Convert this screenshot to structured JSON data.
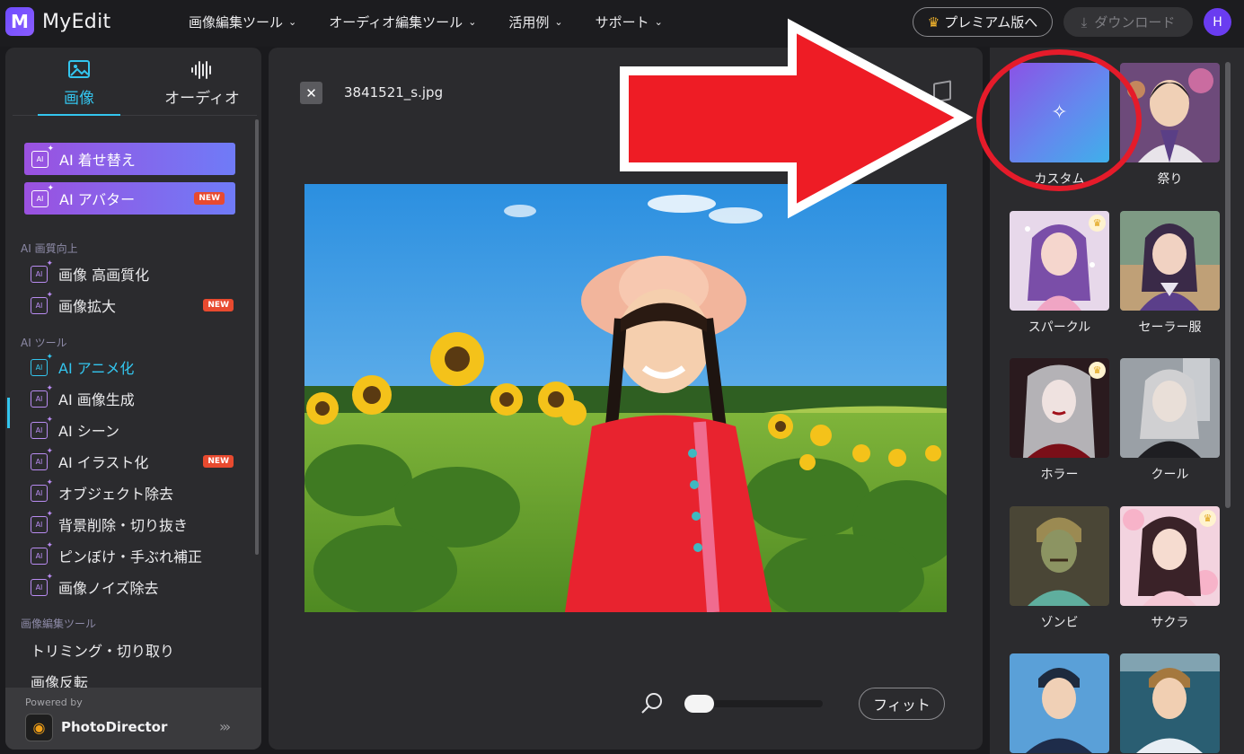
{
  "app": {
    "logo_glyph": "M",
    "name": "MyEdit"
  },
  "nav": [
    {
      "label": "画像編集ツール"
    },
    {
      "label": "オーディオ編集ツール"
    },
    {
      "label": "活用例"
    },
    {
      "label": "サポート"
    }
  ],
  "header": {
    "premium_label": "プレミアム版へ",
    "download_label": "ダウンロード",
    "avatar_initial": "H"
  },
  "sidebar": {
    "tabs": [
      {
        "label": "画像",
        "icon": "image-icon",
        "active": true
      },
      {
        "label": "オーディオ",
        "icon": "audio-waveform-icon",
        "active": false
      }
    ],
    "featured": [
      {
        "label": "AI 着せ替え",
        "badge": ""
      },
      {
        "label": "AI アバター",
        "badge": "NEW"
      }
    ],
    "sections": [
      {
        "title": "AI 画質向上"
      },
      {
        "title": "AI ツール"
      },
      {
        "title": "画像編集ツール"
      }
    ],
    "items": [
      {
        "label": "画像 高画質化",
        "badge": ""
      },
      {
        "label": "画像拡大",
        "badge": "NEW"
      },
      {
        "label": "AI アニメ化",
        "badge": "",
        "active": true
      },
      {
        "label": "AI 画像生成",
        "badge": ""
      },
      {
        "label": "AI シーン",
        "badge": ""
      },
      {
        "label": "AI イラスト化",
        "badge": "NEW"
      },
      {
        "label": "オブジェクト除去",
        "badge": ""
      },
      {
        "label": "背景削除・切り抜き",
        "badge": ""
      },
      {
        "label": "ピンぼけ・手ぶれ補正",
        "badge": ""
      },
      {
        "label": "画像ノイズ除去",
        "badge": ""
      }
    ],
    "edit_items": [
      {
        "label": "トリミング・切り取り"
      },
      {
        "label": "画像反転"
      }
    ],
    "powered_by": "Powered by",
    "product_name": "PhotoDirector"
  },
  "editor": {
    "filename": "3841521_s.jpg",
    "fit_label": "フィット",
    "zoom_level": 0.05
  },
  "styles": [
    {
      "label": "カスタム",
      "premium": false
    },
    {
      "label": "祭り",
      "premium": false
    },
    {
      "label": "スパークル",
      "premium": true
    },
    {
      "label": "セーラー服",
      "premium": false
    },
    {
      "label": "ホラー",
      "premium": true
    },
    {
      "label": "クール",
      "premium": false
    },
    {
      "label": "ゾンビ",
      "premium": false
    },
    {
      "label": "サクラ",
      "premium": true
    },
    {
      "label": "",
      "premium": false
    },
    {
      "label": "",
      "premium": false
    }
  ],
  "colors": {
    "accent": "#33c5ee",
    "brand_purple": "#6e4cff",
    "new_badge": "#e84a2f",
    "annotation_arrow": "#ee1c25",
    "annotation_circle": "#e51b2a"
  }
}
